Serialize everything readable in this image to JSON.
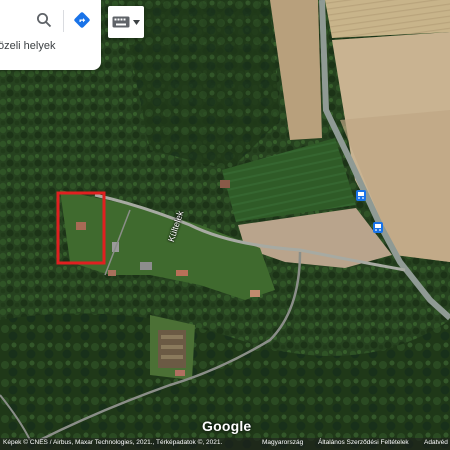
{
  "search": {
    "nearby_label": "özeli helyek"
  },
  "map": {
    "road_label": "Kültelek",
    "layer": "satellite"
  },
  "logo": {
    "text": "Google"
  },
  "footer": {
    "attribution": "Képek © CNES / Airbus, Maxar Technologies, 2021., Térképadatok ©, 2021.",
    "country": "Magyarország",
    "terms": "Általános Szerződési Feltételek",
    "privacy": "Adatvéd"
  },
  "colors": {
    "highlight_box": "#e02020",
    "bus_stop": "#1a73e8",
    "directions": "#1a73e8"
  },
  "icons": [
    "search-icon",
    "directions-icon",
    "keyboard-icon",
    "chevron-down-icon",
    "bus-stop-icon"
  ]
}
